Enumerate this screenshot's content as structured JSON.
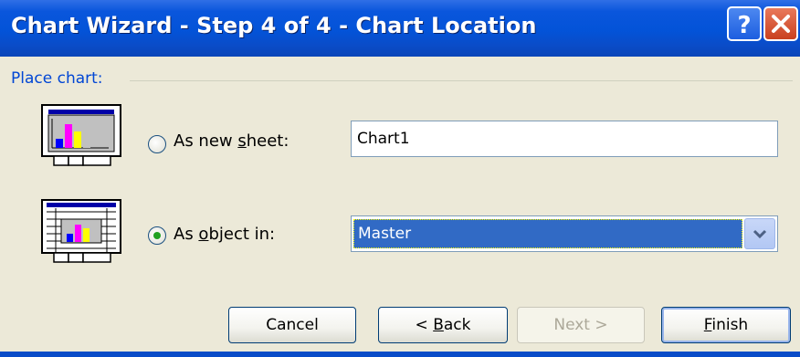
{
  "window": {
    "title": "Chart Wizard - Step 4 of 4 - Chart Location",
    "help_icon": "question-mark-icon",
    "close_icon": "close-x-icon"
  },
  "group": {
    "label": "Place chart:"
  },
  "options": {
    "new_sheet": {
      "label_pre": "As new ",
      "label_u": "s",
      "label_post": "heet:",
      "value": "Chart1",
      "selected": false,
      "icon": "new-sheet-chart-icon"
    },
    "object_in": {
      "label_pre": "As ",
      "label_u": "o",
      "label_post": "bject in:",
      "value": "Master",
      "selected": true,
      "icon": "embedded-chart-icon"
    }
  },
  "buttons": {
    "cancel": "Cancel",
    "back_pre": "< ",
    "back_u": "B",
    "back_post": "ack",
    "next": "Next >",
    "finish_u": "F",
    "finish_post": "inish"
  },
  "colors": {
    "title_bar": "#0353d8",
    "group_label": "#0046d5",
    "selection": "#316ac5",
    "radio_dot": "#21a121"
  }
}
